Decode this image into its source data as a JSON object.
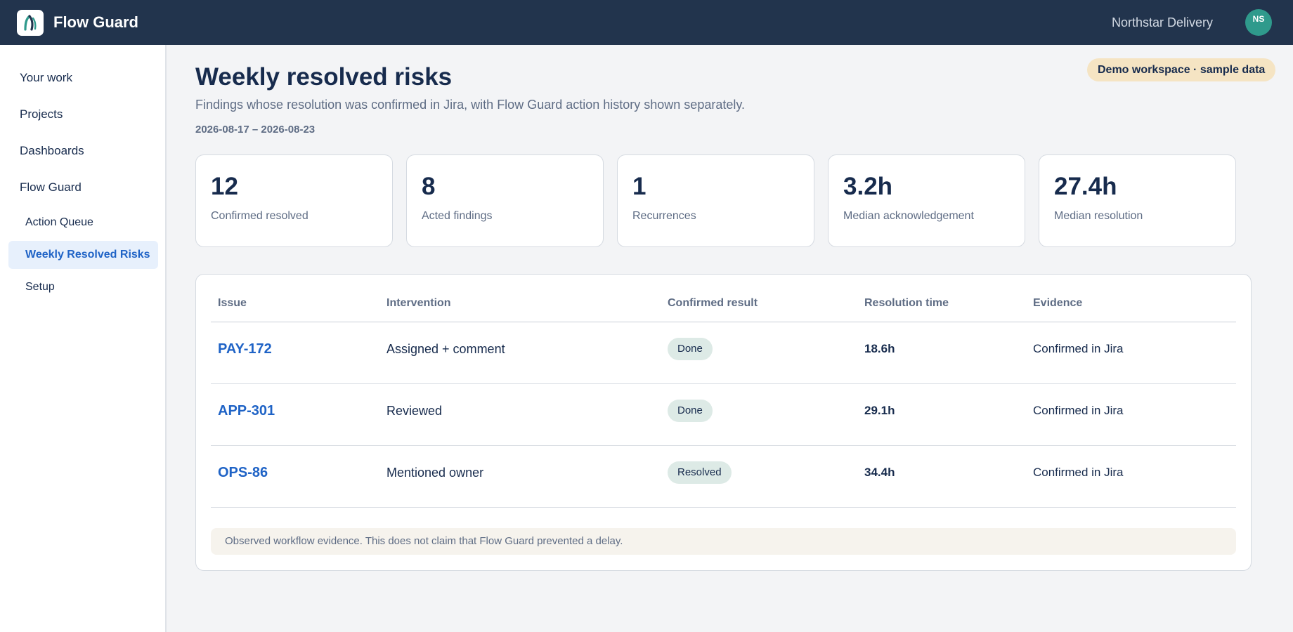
{
  "app": {
    "title": "Flow Guard",
    "workspace": "Northstar Delivery",
    "user_initials": "NS",
    "accent_color": "#1f63c6",
    "header_color": "#22344d",
    "avatar_color": "#2f9a8c"
  },
  "sidebar": {
    "items": [
      {
        "label": "Your work"
      },
      {
        "label": "Projects"
      },
      {
        "label": "Dashboards"
      },
      {
        "label": "Flow Guard"
      }
    ],
    "sub_items": [
      {
        "label": "Action Queue",
        "active": false
      },
      {
        "label": "Weekly Resolved Risks",
        "active": true
      },
      {
        "label": "Setup",
        "active": false
      }
    ]
  },
  "page": {
    "title": "Weekly resolved risks",
    "subtitle": "Findings whose resolution was confirmed in Jira, with Flow Guard action history shown separately.",
    "date_range": "2026-08-17 – 2026-08-23",
    "badge": "Demo workspace · sample data"
  },
  "metrics": [
    {
      "value": "12",
      "label": "Confirmed resolved"
    },
    {
      "value": "8",
      "label": "Acted findings"
    },
    {
      "value": "1",
      "label": "Recurrences"
    },
    {
      "value": "3.2h",
      "label": "Median acknowledgement"
    },
    {
      "value": "27.4h",
      "label": "Median resolution"
    }
  ],
  "table": {
    "columns": [
      "Issue",
      "Intervention",
      "Confirmed result",
      "Resolution time",
      "Evidence"
    ],
    "rows": [
      {
        "issue": "PAY-172",
        "intervention": "Assigned + comment",
        "result": "Done",
        "time": "18.6h",
        "evidence": "Confirmed in Jira"
      },
      {
        "issue": "APP-301",
        "intervention": "Reviewed",
        "result": "Done",
        "time": "29.1h",
        "evidence": "Confirmed in Jira"
      },
      {
        "issue": "OPS-86",
        "intervention": "Mentioned owner",
        "result": "Resolved",
        "time": "34.4h",
        "evidence": "Confirmed in Jira"
      }
    ],
    "footnote": "Observed workflow evidence. This does not claim that Flow Guard prevented a delay."
  },
  "icons": {
    "logo": "flow-guard-logo-icon"
  }
}
